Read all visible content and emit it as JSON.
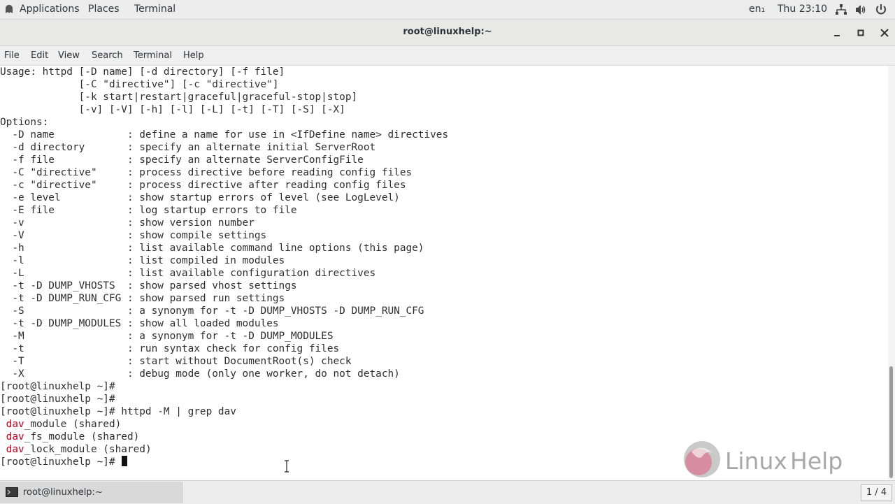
{
  "topbar": {
    "applications_label": "Applications",
    "places_label": "Places",
    "terminal_label": "Terminal",
    "language": "en₁",
    "clock": "Thu 23:10"
  },
  "window": {
    "title": "root@linuxhelp:~"
  },
  "menubar": {
    "items": [
      "File",
      "Edit",
      "View",
      "Search",
      "Terminal",
      "Help"
    ]
  },
  "terminal": {
    "lines": [
      "Usage: httpd [-D name] [-d directory] [-f file]",
      "             [-C \"directive\"] [-c \"directive\"]",
      "             [-k start|restart|graceful|graceful-stop|stop]",
      "             [-v] [-V] [-h] [-l] [-L] [-t] [-T] [-S] [-X]",
      "Options:",
      "  -D name            : define a name for use in <IfDefine name> directives",
      "  -d directory       : specify an alternate initial ServerRoot",
      "  -f file            : specify an alternate ServerConfigFile",
      "  -C \"directive\"     : process directive before reading config files",
      "  -c \"directive\"     : process directive after reading config files",
      "  -e level           : show startup errors of level (see LogLevel)",
      "  -E file            : log startup errors to file",
      "  -v                 : show version number",
      "  -V                 : show compile settings",
      "  -h                 : list available command line options (this page)",
      "  -l                 : list compiled in modules",
      "  -L                 : list available configuration directives",
      "  -t -D DUMP_VHOSTS  : show parsed vhost settings",
      "  -t -D DUMP_RUN_CFG : show parsed run settings",
      "  -S                 : a synonym for -t -D DUMP_VHOSTS -D DUMP_RUN_CFG",
      "  -t -D DUMP_MODULES : show all loaded modules",
      "  -M                 : a synonym for -t -D DUMP_MODULES",
      "  -t                 : run syntax check for config files",
      "  -T                 : start without DocumentRoot(s) check",
      "  -X                 : debug mode (only one worker, do not detach)",
      "[root@linuxhelp ~]#",
      "[root@linuxhelp ~]#",
      "[root@linuxhelp ~]# httpd -M | grep dav"
    ],
    "grep_results": [
      {
        "match": "dav",
        "rest": "_module (shared)"
      },
      {
        "match": "dav",
        "rest": "_fs_module (shared)"
      },
      {
        "match": "dav",
        "rest": "_lock_module (shared)"
      }
    ],
    "prompt": "[root@linuxhelp ~]# "
  },
  "taskbar": {
    "task_label": "root@linuxhelp:~",
    "workspace": "1 / 4"
  },
  "colors": {
    "grep_highlight": "#c4001d",
    "terminal_bg": "#ffffff",
    "terminal_fg": "#2e2e2e"
  },
  "icons": {
    "topbar": [
      "apps-icon",
      "network-icon",
      "volume-icon",
      "power-icon"
    ],
    "window": [
      "minimize-icon",
      "maximize-icon",
      "close-icon"
    ],
    "taskbar": [
      "terminal-icon"
    ]
  }
}
